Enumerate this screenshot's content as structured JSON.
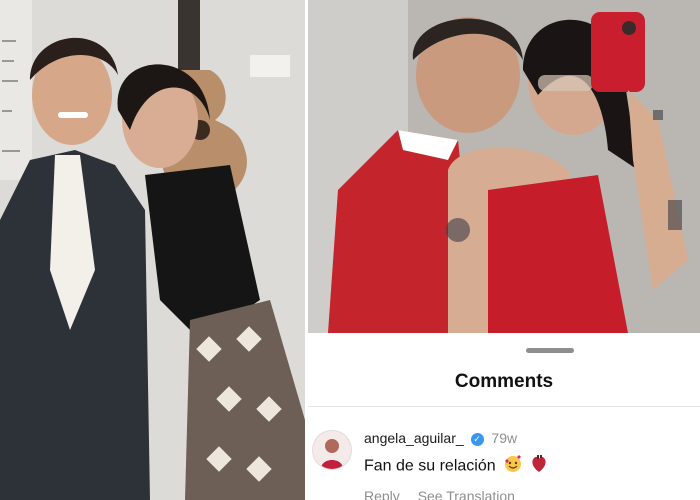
{
  "left_photo": {
    "description_icon": "photo-icon"
  },
  "comments_panel": {
    "title": "Comments",
    "comment": {
      "username": "angela_aguilar_",
      "verified_icon": "verified-badge-icon",
      "time": "79w",
      "text": "Fan de su relación",
      "emojis": [
        "smiling-face-with-hearts-icon",
        "anatomical-heart-icon"
      ],
      "reply_label": "Reply",
      "translation_label": "See Translation"
    }
  }
}
